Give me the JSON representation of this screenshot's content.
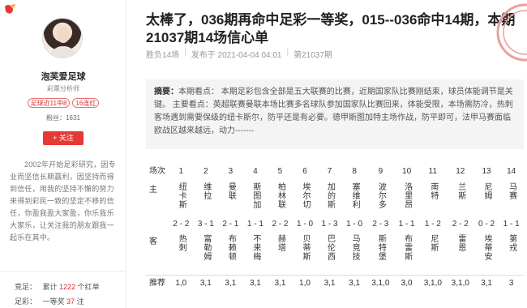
{
  "sidebar": {
    "username": "泡芙爱足球",
    "role": "彩票分析师",
    "badges": [
      "足球近11中8",
      "16连红"
    ],
    "fans_label": "粉丝：1631",
    "follow_label": "+ 关注",
    "bio": "2002年开始足彩研究，因专业而坚信长期赢利，因坚持而得到信任，用我的坚持不懈的努力来得到彩民一致的坚定不移的信任，你盈我盈大家盈，你乐我乐大家乐，让关注我的朋友跟我一起乐在其中。",
    "stats": {
      "hits_label": "竞足：",
      "hits_prefix": "累计",
      "hits_value": "1222",
      "hits_suffix": "个红单",
      "lottery_label": "足彩：",
      "lottery_prefix": "一等奖",
      "lottery_value": "37",
      "lottery_suffix": "注"
    }
  },
  "article": {
    "title": "太棒了，036期再命中足彩一等奖，015--036命中14期，本期21037期14场信心单",
    "meta": {
      "category": "胜负14场",
      "published": "发布于 2021-04-04 04:01",
      "issue": "第21037期"
    },
    "summary_label": "摘要：",
    "summary": "本期看点： 本期足彩包含全部是五大联赛的比赛，近期国家队比赛刚结束，球员体能调节是关键。 主要看点：英超联赛曼联本场比赛多名球队参加国家队比赛回来，体能受限，本场需防冷，热刺客场遇到需要保级的纽卡斯尔，防平还是有必要。德甲斯图加特主场作战，防平即可，法甲马赛面临欧战区越来越远，动力-------"
  },
  "table": {
    "labels": {
      "match_no": "场次",
      "home": "主",
      "away": "客",
      "recommend": "推荐"
    },
    "matches": [
      {
        "no": "1",
        "home": "纽卡斯",
        "score": "2 - 2",
        "away": "热刺",
        "rec": "1,0"
      },
      {
        "no": "2",
        "home": "维拉",
        "score": "3 - 1",
        "away": "富勒姆",
        "rec": "3,1"
      },
      {
        "no": "3",
        "home": "曼联",
        "score": "2 - 1",
        "away": "布赖顿",
        "rec": "3,1"
      },
      {
        "no": "4",
        "home": "斯图加",
        "score": "1 - 1",
        "away": "不来梅",
        "rec": "3,1"
      },
      {
        "no": "5",
        "home": "柏林联",
        "score": "2 - 2",
        "away": "赫塔",
        "rec": "3,1"
      },
      {
        "no": "6",
        "home": "埃尔切",
        "score": "1 - 0",
        "away": "贝蒂斯",
        "rec": "1,0"
      },
      {
        "no": "7",
        "home": "加的斯",
        "score": "1 - 3",
        "away": "巴伦西",
        "rec": "3,1"
      },
      {
        "no": "8",
        "home": "塞维利",
        "score": "1 - 0",
        "away": "马竞技",
        "rec": "3,1"
      },
      {
        "no": "9",
        "home": "波尔多",
        "score": "2 - 3",
        "away": "斯特堡",
        "rec": "3,1,0"
      },
      {
        "no": "10",
        "home": "洛里昂",
        "score": "1 - 1",
        "away": "布雷斯",
        "rec": "3,0"
      },
      {
        "no": "11",
        "home": "南特",
        "score": "1 - 2",
        "away": "尼斯",
        "rec": "3,1,0"
      },
      {
        "no": "12",
        "home": "兰斯",
        "score": "2 - 2",
        "away": "雷恩",
        "rec": "3,1,0"
      },
      {
        "no": "13",
        "home": "尼姆",
        "score": "0 - 2",
        "away": "埃蒂安",
        "rec": "3,1"
      },
      {
        "no": "14",
        "home": "马赛",
        "score": "1 - 1",
        "away": "第戎",
        "rec": "3"
      }
    ]
  },
  "colors": {
    "accent_red": "#e53935",
    "stamp_red": "#e8a0a0"
  }
}
